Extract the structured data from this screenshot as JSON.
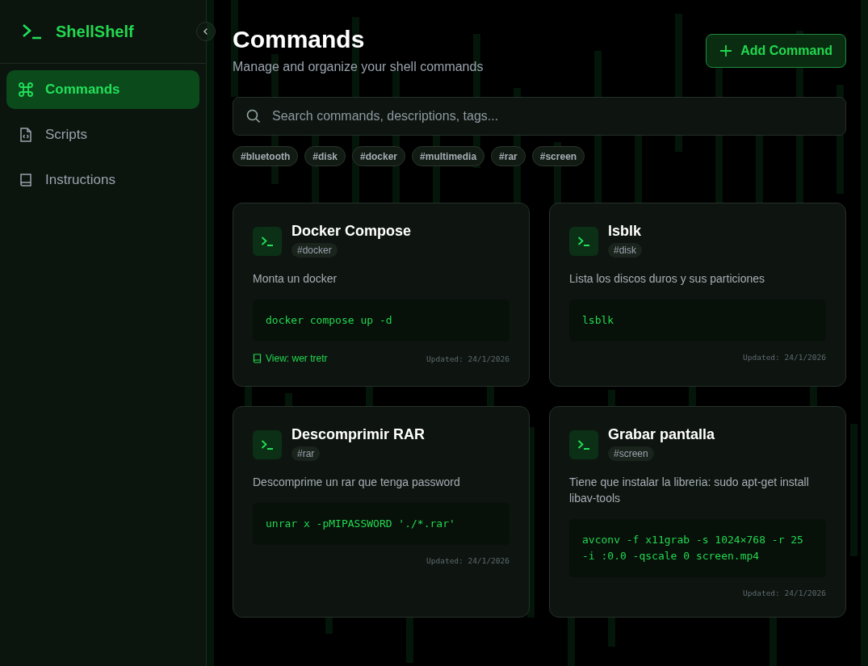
{
  "sidebar": {
    "brand": "ShellShelf",
    "items": [
      {
        "label": "Commands",
        "selected": true
      },
      {
        "label": "Scripts",
        "selected": false
      },
      {
        "label": "Instructions",
        "selected": false
      }
    ]
  },
  "header": {
    "title": "Commands",
    "subtitle": "Manage and organize your shell commands",
    "action": "Add Command"
  },
  "search": {
    "placeholder": "Search commands, descriptions, tags..."
  },
  "tags": [
    "#bluetooth",
    "#disk",
    "#docker",
    "#multimedia",
    "#rar",
    "#screen"
  ],
  "cards": [
    {
      "title": "Docker Compose",
      "tag": "#docker",
      "description": "Monta un docker",
      "command": "docker compose up -d",
      "link": "View: wer tretr",
      "updated": "Updated: 24/1/2026"
    },
    {
      "title": "lsblk",
      "tag": "#disk",
      "description": "Lista los discos duros y sus particiones",
      "command": "lsblk",
      "updated": "Updated: 24/1/2026"
    },
    {
      "title": "Descomprimir RAR",
      "tag": "#rar",
      "description": "Descomprime un rar que tenga password",
      "command": "unrar x -pMIPASSWORD './*.rar'",
      "updated": "Updated: 24/1/2026"
    },
    {
      "title": "Grabar pantalla",
      "tag": "#screen",
      "description": "Tiene que instalar la libreria: sudo apt-get install libav-tools",
      "command": "avconv -f x11grab -s 1024×768 -r 25 -i :0.0 -qscale 0 screen.mp4",
      "updated": "Updated: 24/1/2026"
    }
  ]
}
